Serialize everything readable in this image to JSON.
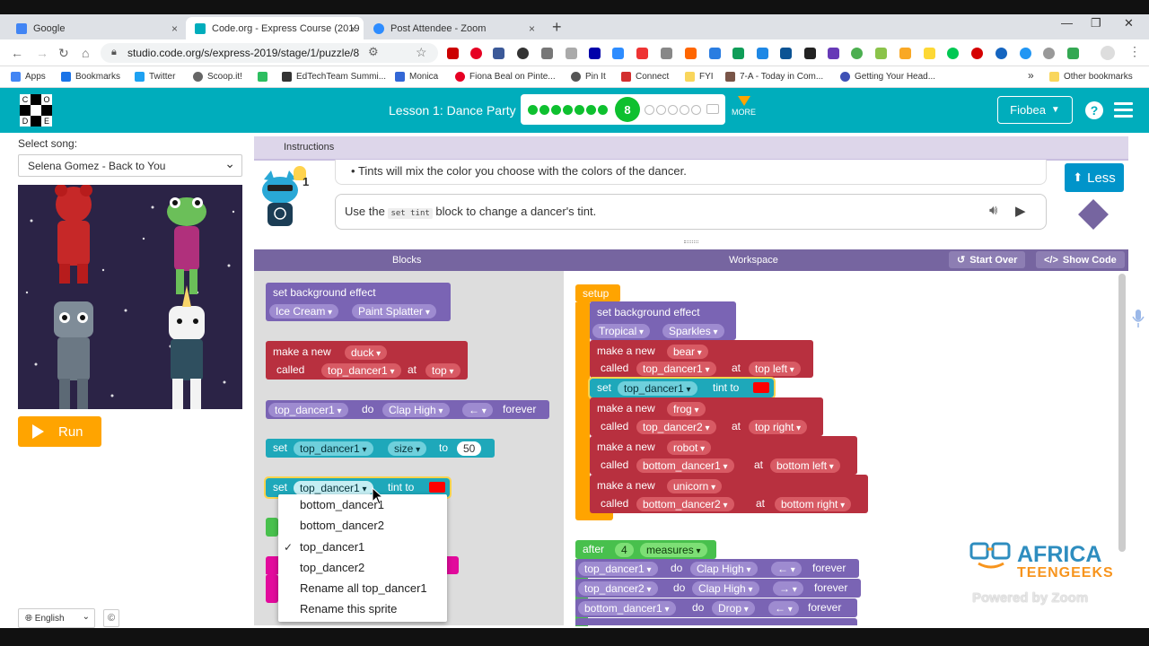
{
  "browser": {
    "tabs": [
      {
        "title": "Google",
        "color": "#4285f4"
      },
      {
        "title": "Code.org - Express Course (2019",
        "color": "#00adbc"
      },
      {
        "title": "Post Attendee - Zoom",
        "color": "#2d8cff"
      }
    ],
    "new_tab": "+",
    "close": "×",
    "url": "studio.code.org/s/express-2019/stage/1/puzzle/8",
    "bookmarks": [
      "Apps",
      "Bookmarks",
      "Twitter",
      "Scoop.it!",
      "EdTechTeam Summi...",
      "Monica",
      "Fiona Beal on Pinte...",
      "Pin It",
      "Connect",
      "FYI",
      "7-A - Today in Com...",
      "Getting Your Head..."
    ],
    "bookmarks_overflow": "»",
    "other_bookmarks": "Other bookmarks"
  },
  "header": {
    "logo_letters": [
      "C",
      "O",
      "D",
      "E"
    ],
    "lesson_title": "Lesson 1: Dance Party",
    "current_level": "8",
    "more_label": "MORE",
    "user_name": "Fiobea",
    "help": "?",
    "colors": {
      "header_bg": "#00adbc",
      "completed_dot": "#0ec02f"
    }
  },
  "left": {
    "select_song_label": "Select song:",
    "song": "Selena Gomez - Back to You",
    "run_label": "Run",
    "language": "English",
    "copyright": "©"
  },
  "instructions": {
    "tab_label": "Instructions",
    "bullet": "Tints will mix the color you choose with the colors of the dancer.",
    "hint_count": "1",
    "text_before": "Use the",
    "code_chip": "set tint",
    "text_after": "block to change a dancer's tint.",
    "less_label": "Less"
  },
  "panel": {
    "blocks_label": "Blocks",
    "workspace_label": "Workspace",
    "start_over": "Start Over",
    "show_code": "Show Code"
  },
  "toolbox": {
    "bg_effect": {
      "title": "set background effect",
      "f1": "Ice Cream",
      "f2": "Paint Splatter"
    },
    "make_new": {
      "t1": "make a new",
      "f1": "duck",
      "t2": "called",
      "f2": "top_dancer1",
      "t3": "at",
      "f3": "top"
    },
    "do_forever": {
      "f1": "top_dancer1",
      "t1": "do",
      "f2": "Clap High",
      "f3": "←",
      "t2": "forever"
    },
    "set_size": {
      "t1": "set",
      "f1": "top_dancer1",
      "f2": "size",
      "t2": "to",
      "f3": "50"
    },
    "set_tint": {
      "t1": "set",
      "f1": "top_dancer1",
      "t2": "tint to"
    }
  },
  "dropdown": {
    "items": [
      "bottom_dancer1",
      "bottom_dancer2",
      "top_dancer1",
      "top_dancer2",
      "Rename all top_dancer1",
      "Rename this sprite"
    ],
    "checkmark": "✓",
    "selected": "top_dancer1"
  },
  "workspace": {
    "setup_label": "setup",
    "bg_effect": {
      "title": "set background effect",
      "f1": "Tropical",
      "f2": "Sparkles"
    },
    "make_a_new": "make a new",
    "called": "called",
    "at": "at",
    "set": "set",
    "tint_to": "tint to",
    "dancers": [
      {
        "animal": "bear",
        "name": "top_dancer1",
        "pos": "top left"
      },
      {
        "animal": "frog",
        "name": "top_dancer2",
        "pos": "top right"
      },
      {
        "animal": "robot",
        "name": "bottom_dancer1",
        "pos": "bottom left"
      },
      {
        "animal": "unicorn",
        "name": "bottom_dancer2",
        "pos": "bottom right"
      }
    ],
    "tint_target": "top_dancer1",
    "after": {
      "t1": "after",
      "f1": "4",
      "f2": "measures"
    },
    "moves": [
      {
        "name": "top_dancer1",
        "t1": "do",
        "move": "Clap High",
        "dir": "←",
        "t2": "forever"
      },
      {
        "name": "top_dancer2",
        "t1": "do",
        "move": "Clap High",
        "dir": "→",
        "t2": "forever"
      },
      {
        "name": "bottom_dancer1",
        "t1": "do",
        "move": "Drop",
        "dir": "←",
        "t2": "forever"
      }
    ]
  },
  "brand": {
    "title": "AFRICA",
    "subtitle": "TEENGEEKS",
    "powered_by": "Powered by Zoom"
  }
}
